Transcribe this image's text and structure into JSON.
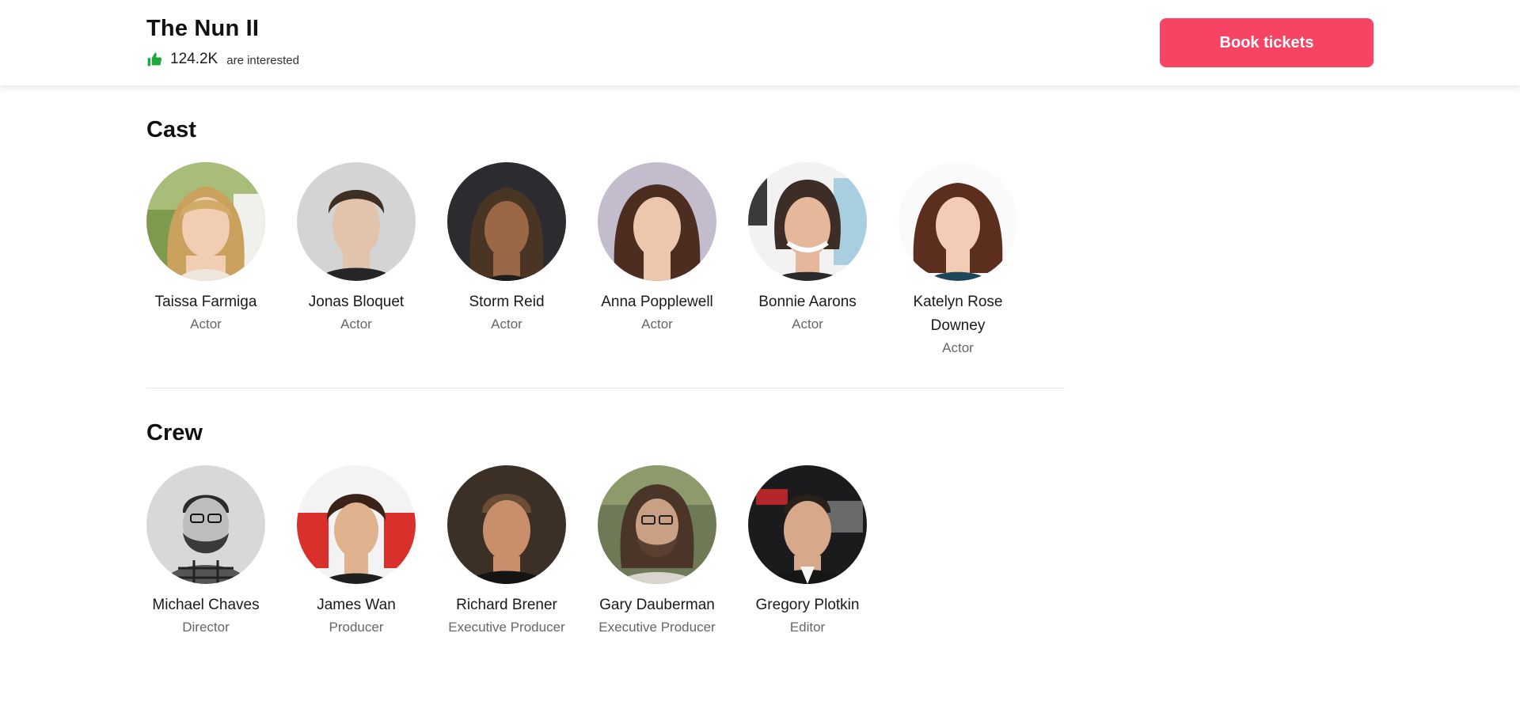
{
  "header": {
    "title": "The Nun II",
    "interest_count": "124.2K",
    "interest_text": "are interested",
    "book_label": "Book tickets",
    "thumb_icon": "thumbs-up-icon",
    "thumb_color": "#1ea83c",
    "button_color": "#f84464"
  },
  "cast": {
    "title": "Cast",
    "people": [
      {
        "name": "Taissa Farmiga",
        "role": "Actor"
      },
      {
        "name": "Jonas Bloquet",
        "role": "Actor"
      },
      {
        "name": "Storm Reid",
        "role": "Actor"
      },
      {
        "name": "Anna Popplewell",
        "role": "Actor"
      },
      {
        "name": "Bonnie Aarons",
        "role": "Actor"
      },
      {
        "name": "Katelyn Rose Downey",
        "role": "Actor"
      }
    ]
  },
  "crew": {
    "title": "Crew",
    "people": [
      {
        "name": "Michael Chaves",
        "role": "Director"
      },
      {
        "name": "James Wan",
        "role": "Producer"
      },
      {
        "name": "Richard Brener",
        "role": "Executive Producer"
      },
      {
        "name": "Gary Dauberman",
        "role": "Executive Producer"
      },
      {
        "name": "Gregory Plotkin",
        "role": "Editor"
      }
    ]
  }
}
